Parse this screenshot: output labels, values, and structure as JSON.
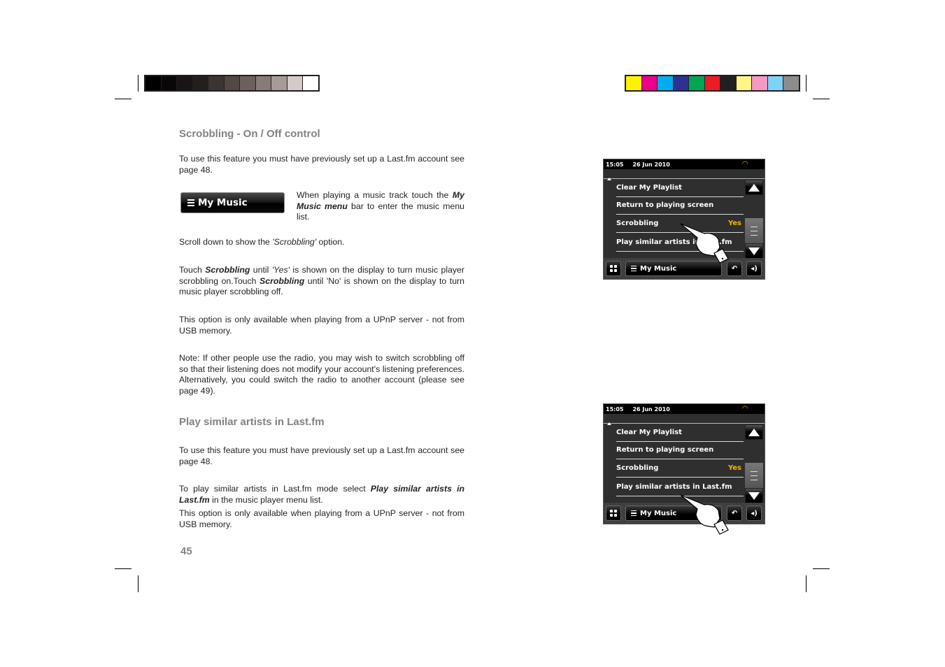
{
  "print_marks": {
    "gray_swatches": [
      "#000000",
      "#0a0807",
      "#191514",
      "#231f1d",
      "#3a3432",
      "#524947",
      "#6b605e",
      "#877c7a",
      "#a59c9a",
      "#d2cbca",
      "#ffffff"
    ],
    "color_swatches": [
      "#fff200",
      "#ec008c",
      "#00aeef",
      "#2e3192",
      "#00a651",
      "#ed1c24",
      "#231f20",
      "#fff685",
      "#f49ac1",
      "#7dd3f7",
      "#8d8c8c"
    ]
  },
  "section1": {
    "heading": "Scrobbling - On / Off control",
    "p1": "To use this feature you must have previously set up a Last.fm account see page 48.",
    "my_music_button": "My Music",
    "p2_a": "When playing a music track touch the ",
    "p2_bold": "My Music menu",
    "p2_b": " bar to enter the music menu list.",
    "p3_a": "Scroll down to show the ",
    "p3_italic": "'Scrobbling'",
    "p3_b": " option.",
    "p4_a": "Touch ",
    "p4_bold1": "Scrobbling",
    "p4_b": "  until ",
    "p4_italic": "'Yes'",
    "p4_c": " is shown on the display to turn music player scrobbling on.Touch ",
    "p4_bold2": "Scrobbling",
    "p4_d": "  until 'No' is shown on the display to turn music player scrobbling off.",
    "p5": "This option is only available when playing from a UPnP server - not from USB memory.",
    "p6": "Note: If other people use the radio, you may wish to switch scrobbling off so that their listening does not modify your account's listening preferences. Alternatively, you could switch the radio to another account (please see page 49)."
  },
  "section2": {
    "heading": "Play similar artists in Last.fm",
    "p1": "To use this feature you must have previously set up a Last.fm account see page 48.",
    "p2_a": "To play similar artists in Last.fm mode select ",
    "p2_bold": "Play similar artists in Last.fm",
    "p2_b": " in the music player menu list.",
    "p3": "This option is only available when playing from a UPnP server - not from USB memory."
  },
  "page_number": "45",
  "screens": [
    {
      "time": "15:05",
      "date": "26 Jun 2010",
      "wifi_icon": "wifi-icon",
      "items": [
        {
          "label": "Clear My Playlist",
          "value": ""
        },
        {
          "label": "Return to playing screen",
          "value": ""
        },
        {
          "label": "Scrobbling",
          "value": "Yes"
        },
        {
          "label": "Play similar artists in Last.fm",
          "value": ""
        }
      ],
      "bottom_menu": "My Music",
      "pointer_target": "Scrobbling"
    },
    {
      "time": "15:05",
      "date": "26 Jun 2010",
      "wifi_icon": "wifi-icon",
      "items": [
        {
          "label": "Clear My Playlist",
          "value": ""
        },
        {
          "label": "Return to playing screen",
          "value": ""
        },
        {
          "label": "Scrobbling",
          "value": "Yes"
        },
        {
          "label": "Play similar artists in Last.fm",
          "value": ""
        }
      ],
      "bottom_menu": "My Music",
      "pointer_target": "Play similar artists in Last.fm"
    }
  ]
}
